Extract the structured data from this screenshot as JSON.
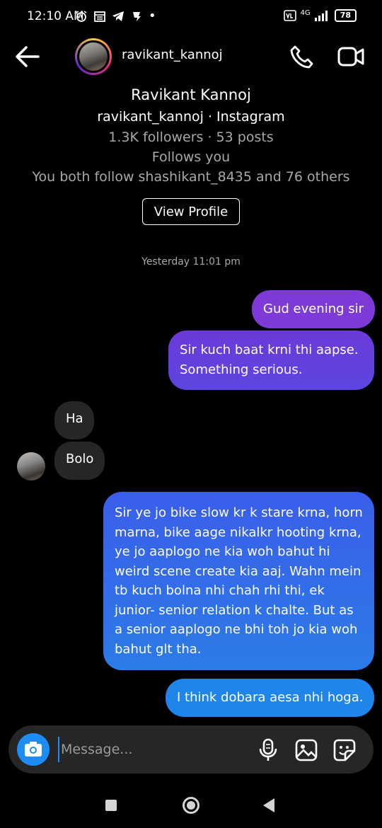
{
  "status_bar": {
    "time": "12:10 AM",
    "icons_left": [
      "alarm-icon",
      "calendar-icon",
      "telegram-icon",
      "app-notification-icon",
      "dot-icon"
    ],
    "network_label": "4G",
    "battery": "78"
  },
  "header": {
    "username": "ravikant_kannoj",
    "icons": [
      "back-arrow-icon",
      "phone-icon",
      "video-camera-icon"
    ]
  },
  "profile": {
    "name": "Ravikant Kannoj",
    "handle_line": "ravikant_kannoj · Instagram",
    "stats_line": "1.3K followers · 53 posts",
    "follows_line": "Follows you",
    "mutual_line": "You both follow shashikant_8435 and 76 others",
    "view_profile_label": "View Profile"
  },
  "chat": {
    "timestamp": "Yesterday 11:01 pm",
    "messages": [
      {
        "direction": "outgoing",
        "text": "Gud evening sir"
      },
      {
        "direction": "outgoing",
        "text": "Sir kuch baat krni thi aapse. Something serious."
      },
      {
        "direction": "incoming",
        "text": "Ha"
      },
      {
        "direction": "incoming",
        "text": "Bolo"
      },
      {
        "direction": "outgoing",
        "text": "Sir ye jo bike slow kr k stare krna, horn marna, bike aage nikalkr hooting krna, ye jo aaplogo ne kia woh bahut hi weird scene create kia aaj. Wahn mein tb kuch bolna nhi chah rhi thi, ek junior- senior relation k chalte. But as a senior aaplogo ne bhi toh jo kia woh bahut glt tha."
      },
      {
        "direction": "outgoing",
        "text": "I think dobara aesa nhi hoga."
      }
    ]
  },
  "composer": {
    "placeholder": "Message...",
    "icons": [
      "camera-icon",
      "microphone-icon",
      "gallery-icon",
      "sticker-icon"
    ]
  },
  "colors": {
    "background": "#000000",
    "incoming_bubble": "#262626",
    "outgoing_purple": "#7d3ad6",
    "outgoing_blue": "#1f85ea",
    "accent_blue": "#1d8cf5"
  }
}
